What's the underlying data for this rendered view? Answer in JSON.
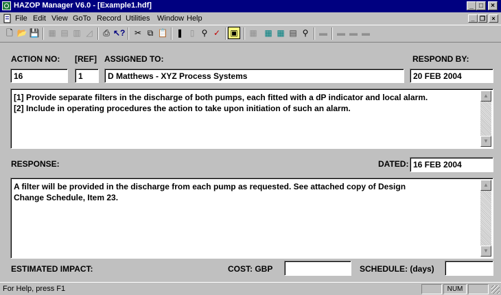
{
  "window": {
    "title": "HAZOP Manager V6.0 - [Example1.hdf]",
    "minimize": "_",
    "maximize": "□",
    "close": "×"
  },
  "menu": {
    "file": "File",
    "edit": "Edit",
    "view": "View",
    "goto": "GoTo",
    "record": "Record",
    "utilities": "Utilities",
    "window": "Window",
    "help": "Help",
    "mdi_minimize": "_",
    "mdi_restore": "❐",
    "mdi_close": "×"
  },
  "toolbar": {
    "icons": [
      "new-icon",
      "open-icon",
      "save-icon",
      "grid-icon",
      "table-icon",
      "columns-icon",
      "chart-icon",
      "print-icon",
      "context-help-icon",
      "cut-icon",
      "copy-icon",
      "paste-icon",
      "bookmark-icon",
      "book-icon",
      "find-icon",
      "spellcheck-icon",
      "report-icon",
      "view1-icon",
      "view2-icon",
      "view3-icon",
      "view4-icon",
      "find-record-icon",
      "disabled-icon"
    ]
  },
  "form": {
    "action_no_label": "ACTION NO:",
    "ref_label": "[REF]",
    "assigned_to_label": "ASSIGNED TO:",
    "respond_by_label": "RESPOND BY:",
    "action_no": "16",
    "ref": "1",
    "assigned_to": "D Matthews - XYZ Process Systems",
    "respond_by": "20 FEB 2004",
    "action_lines": [
      "[1]  Provide separate filters in the discharge of both pumps, each fitted with a dP indicator and local alarm.",
      "[2]  Include in operating procedures the action to take upon initiation of such an alarm."
    ],
    "response_label": "RESPONSE:",
    "dated_label": "DATED:",
    "dated": "16 FEB 2004",
    "response_lines": [
      "A filter will be provided in the discharge from each pump as requested.  See attached copy of Design",
      "Change Schedule, Item 23."
    ],
    "estimated_impact_label": "ESTIMATED IMPACT:",
    "cost_label": "COST:  GBP",
    "cost": "",
    "schedule_label": "SCHEDULE:  (days)",
    "schedule": ""
  },
  "status": {
    "message": "For Help, press F1",
    "num": "NUM"
  }
}
